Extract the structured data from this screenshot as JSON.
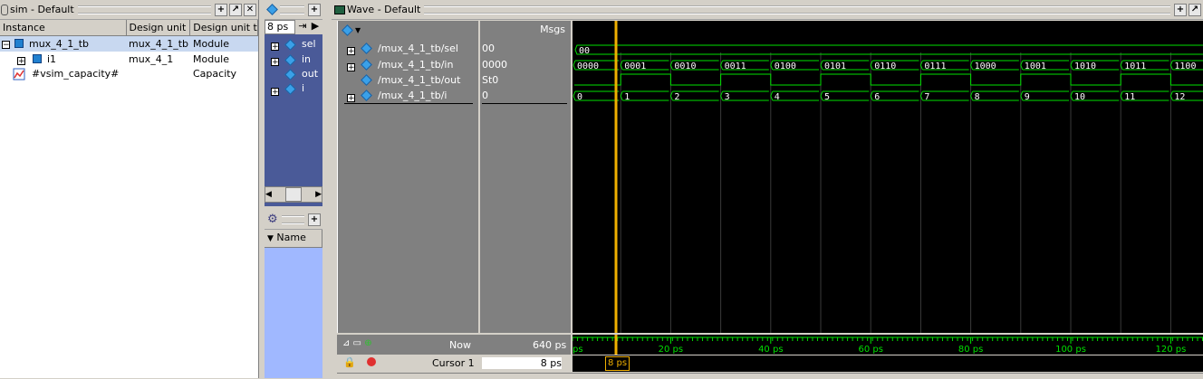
{
  "sim_panel": {
    "title": "sim - Default",
    "columns": [
      "Instance",
      "Design unit",
      "Design unit typ"
    ],
    "rows": [
      {
        "instance": "mux_4_1_tb",
        "unit": "mux_4_1_tb",
        "type": "Module"
      },
      {
        "instance": "i1",
        "unit": "mux_4_1",
        "type": "Module"
      },
      {
        "instance": "#vsim_capacity#",
        "unit": "",
        "type": "Capacity"
      }
    ]
  },
  "objects_panel": {
    "time_box": "8 ps",
    "items": [
      "sel",
      "in",
      "out",
      "i"
    ]
  },
  "processes_panel": {
    "column": "Name"
  },
  "wave": {
    "title": "Wave - Default",
    "msgs_label": "Msgs",
    "signals": [
      {
        "name": "/mux_4_1_tb/sel",
        "value": "00"
      },
      {
        "name": "/mux_4_1_tb/in",
        "value": "0000"
      },
      {
        "name": "/mux_4_1_tb/out",
        "value": "St0"
      },
      {
        "name": "/mux_4_1_tb/i",
        "value": "0"
      }
    ],
    "sel_wave": [
      "00"
    ],
    "in_wave": [
      "0000",
      "0001",
      "0010",
      "0011",
      "0100",
      "0101",
      "0110",
      "0111",
      "1000",
      "1001",
      "1010",
      "1011",
      "1100"
    ],
    "i_wave": [
      "0",
      "1",
      "2",
      "3",
      "4",
      "5",
      "6",
      "7",
      "8",
      "9",
      "10",
      "11",
      "12"
    ],
    "now_label": "Now",
    "now_value": "640 ps",
    "cursor_label": "Cursor 1",
    "cursor_value": "8 ps",
    "cursor_tag": "8 ps",
    "ruler_left": "ps",
    "ticks": [
      "20 ps",
      "40 ps",
      "60 ps",
      "80 ps",
      "100 ps",
      "120 ps"
    ]
  },
  "colors": {
    "wave_green": "#00e000",
    "cursor": "#f0b000",
    "panel_blue": "#4a5a98"
  }
}
